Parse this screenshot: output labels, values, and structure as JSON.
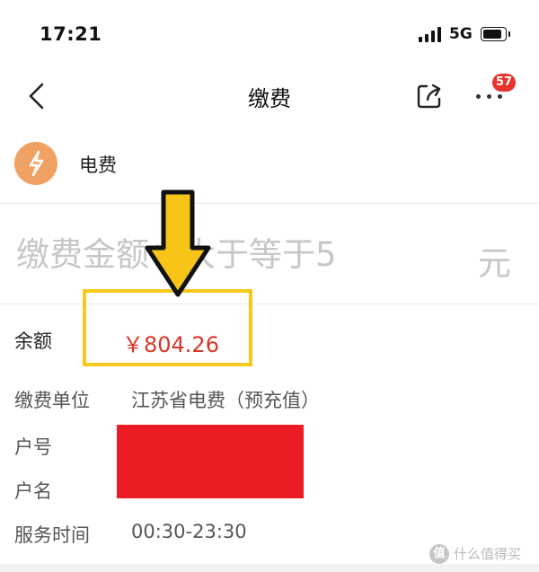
{
  "status_bar": {
    "time": "17:21",
    "network": "5G"
  },
  "nav": {
    "title": "缴费",
    "badge_count": "57"
  },
  "biller": {
    "name": "电费",
    "icon": "lightning-bolt-icon"
  },
  "amount": {
    "placeholder": "缴费金额：大于等于5",
    "unit": "元"
  },
  "details": {
    "balance_label": "余额",
    "balance_value": "￥804.26",
    "unit_label": "缴费单位",
    "unit_value": "江苏省电费（预充值）",
    "account_label": "户号",
    "name_label": "户名",
    "hours_label": "服务时间",
    "hours_value": "00:30-23:30"
  },
  "watermark": {
    "logo": "值",
    "text": "什么值得买"
  },
  "colors": {
    "accent_red": "#d9362a",
    "biller_icon": "#f0a265",
    "highlight": "#f6c71d",
    "redaction": "#ec1c24",
    "badge": "#e8332c"
  }
}
